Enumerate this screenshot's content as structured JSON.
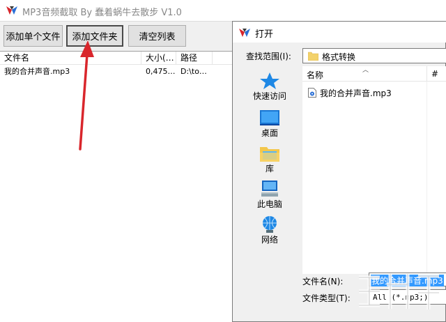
{
  "app": {
    "title": "MP3音频截取 By 蠢着蜗牛去散步 V1.0",
    "buttons": {
      "add_single": "添加单个文件",
      "add_folder": "添加文件夹",
      "clear_list": "清空列表"
    },
    "list": {
      "columns": [
        "文件名",
        "大小(…",
        "路径"
      ],
      "rows": [
        {
          "name": "我的合并声音.mp3",
          "size": "0,475…",
          "path": "D:\\to…"
        }
      ]
    }
  },
  "dialog": {
    "title": "打开",
    "look_in_label": "查找范围(I):",
    "look_in_value": "格式转换",
    "places": [
      {
        "label": "快速访问",
        "icon": "quick-access-star-icon"
      },
      {
        "label": "桌面",
        "icon": "desktop-icon"
      },
      {
        "label": "库",
        "icon": "library-icon"
      },
      {
        "label": "此电脑",
        "icon": "this-pc-icon"
      },
      {
        "label": "网络",
        "icon": "network-icon"
      }
    ],
    "file_list": {
      "col_name": "名称",
      "col_num": "#",
      "items": [
        {
          "name": "我的合并声音.mp3",
          "icon": "audio-file-icon"
        }
      ]
    },
    "filename_label": "文件名(N):",
    "filename_value": "我的合并声音.mp3",
    "filetype_label": "文件类型(T):",
    "filetype_value": "All (*.mp3;)"
  },
  "colors": {
    "annotation_arrow": "#d9262c",
    "selection": "#3399ff"
  }
}
